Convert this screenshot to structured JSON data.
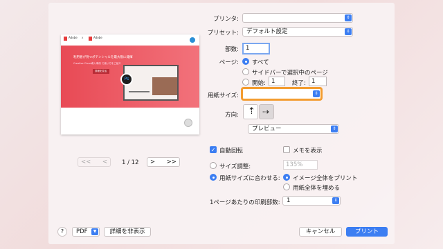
{
  "printer": {
    "label": "プリンタ:",
    "value": ""
  },
  "preset": {
    "label": "プリセット:",
    "value": "デフォルト設定"
  },
  "copies": {
    "label": "部数:",
    "value": "1"
  },
  "pages": {
    "label": "ページ:",
    "all": "すべて",
    "selected": "サイドバーで選択中のページ",
    "from_label": "開始:",
    "from_value": "1",
    "to_label": "終了:",
    "to_value": "1"
  },
  "paper_size": {
    "label": "用紙サイズ:",
    "value": ""
  },
  "orientation": {
    "label": "方向:"
  },
  "section_popup": {
    "value": "プレビュー"
  },
  "preview": {
    "brand1": "Adobe",
    "x_mark": "x",
    "brand2": "Adobe",
    "headline": "利用者が持つポテンシャルを最大限に発揮",
    "subline": "Creative Cloud導入事例 で使い方をご紹介",
    "cta": "詳細を見る",
    "badge": "Ps"
  },
  "pager": {
    "first": "<<",
    "prev": "<",
    "page": "1 / 12",
    "next": ">",
    "last": ">>"
  },
  "auto_rotate": {
    "label": "自動回転",
    "checked": true
  },
  "show_notes": {
    "label": "メモを表示",
    "checked": false
  },
  "scale": {
    "label": "サイズ調整:",
    "value": "135%"
  },
  "fit": {
    "label": "用紙サイズに合わせる:",
    "print_entire": "イメージ全体をプリント",
    "fill_paper": "用紙全体を埋める"
  },
  "pages_per_sheet": {
    "label": "1ページあたりの印刷部数:",
    "value": "1"
  },
  "footer": {
    "help": "?",
    "pdf": "PDF",
    "hide_details": "詳細を非表示",
    "cancel": "キャンセル",
    "print": "プリント"
  },
  "colors": {
    "accent": "#3c7ef2",
    "focus": "#f39c2f",
    "preview_red": "#e84a55"
  }
}
